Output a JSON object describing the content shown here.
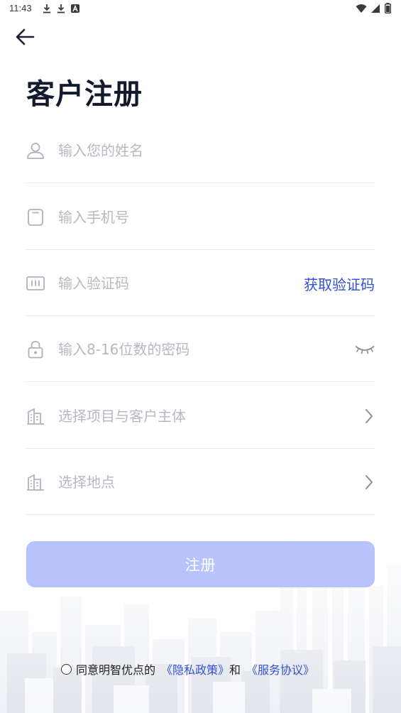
{
  "status_bar": {
    "time": "11:43",
    "notification_icons": [
      "download-icon",
      "download-icon",
      "a-badge-icon"
    ],
    "system_icons": [
      "wifi-icon",
      "signal-icon",
      "battery-icon"
    ]
  },
  "header": {
    "back_icon": "arrow-left-icon",
    "title": "客户注册"
  },
  "form": {
    "name": {
      "placeholder": "输入您的姓名",
      "value": "",
      "icon": "user-icon"
    },
    "phone": {
      "placeholder": "输入手机号",
      "value": "",
      "icon": "phone-icon"
    },
    "code": {
      "placeholder": "输入验证码",
      "value": "",
      "icon": "code-icon",
      "action_label": "获取验证码"
    },
    "password": {
      "placeholder": "输入8-16位数的密码",
      "value": "",
      "icon": "lock-icon",
      "toggle_icon": "eye-closed-icon"
    },
    "project": {
      "label": "选择项目与客户主体",
      "icon": "building-icon",
      "chevron_icon": "chevron-right-icon"
    },
    "location": {
      "label": "选择地点",
      "icon": "building-icon",
      "chevron_icon": "chevron-right-icon"
    }
  },
  "register_button": {
    "label": "注册"
  },
  "agreement": {
    "prefix": "同意明智优点的",
    "privacy_link": "《隐私政策》",
    "conjunction": "和",
    "service_link": "《服务协议》"
  },
  "colors": {
    "accent": "#2f50d8",
    "button_disabled": "#b9c3fb",
    "placeholder": "#b6b9c2",
    "title": "#141a2e",
    "divider": "#e6e8ee"
  }
}
